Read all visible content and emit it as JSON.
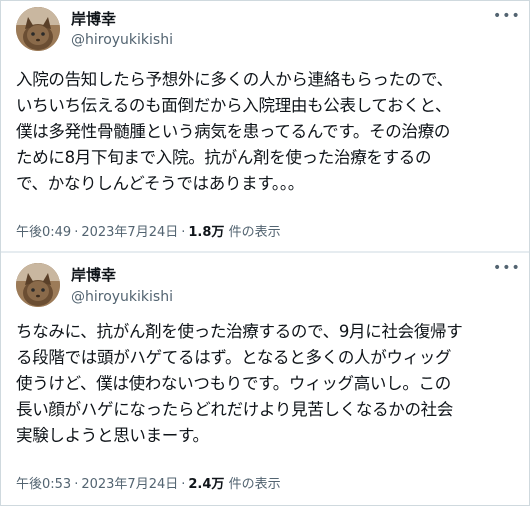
{
  "tweets": [
    {
      "name": "岸博幸",
      "handle": "@hiroyukikishi",
      "more_icon": "ellipsis-icon",
      "lines": [
        "入院の告知したら予想外に多くの人から連絡もらったので、",
        "いちいち伝えるのも面倒だから入院理由も公表しておくと、",
        "僕は多発性骨髄腫という病気を患ってるんです。その治療の",
        "ために8月下旬まで入院。抗がん剤を使った治療をするの",
        "で、かなりしんどそうではあります。。。"
      ],
      "time": "午後0:49",
      "sep": "·",
      "date": "2023年7月24日",
      "views": "1.8万",
      "views_label": "件の表示"
    },
    {
      "name": "岸博幸",
      "handle": "@hiroyukikishi",
      "more_icon": "ellipsis-icon",
      "lines": [
        "ちなみに、抗がん剤を使った治療するので、9月に社会復帰す",
        "る段階では頭がハゲてるはず。となると多くの人がウィッグ",
        "使うけど、僕は使わないつもりです。ウィッグ高いし。この",
        "長い顔がハゲになったらどれだけより見苦しくなるかの社会",
        "実験しようと思いまーす。"
      ],
      "time": "午後0:53",
      "sep": "·",
      "date": "2023年7月24日",
      "views": "2.4万",
      "views_label": "件の表示"
    }
  ]
}
